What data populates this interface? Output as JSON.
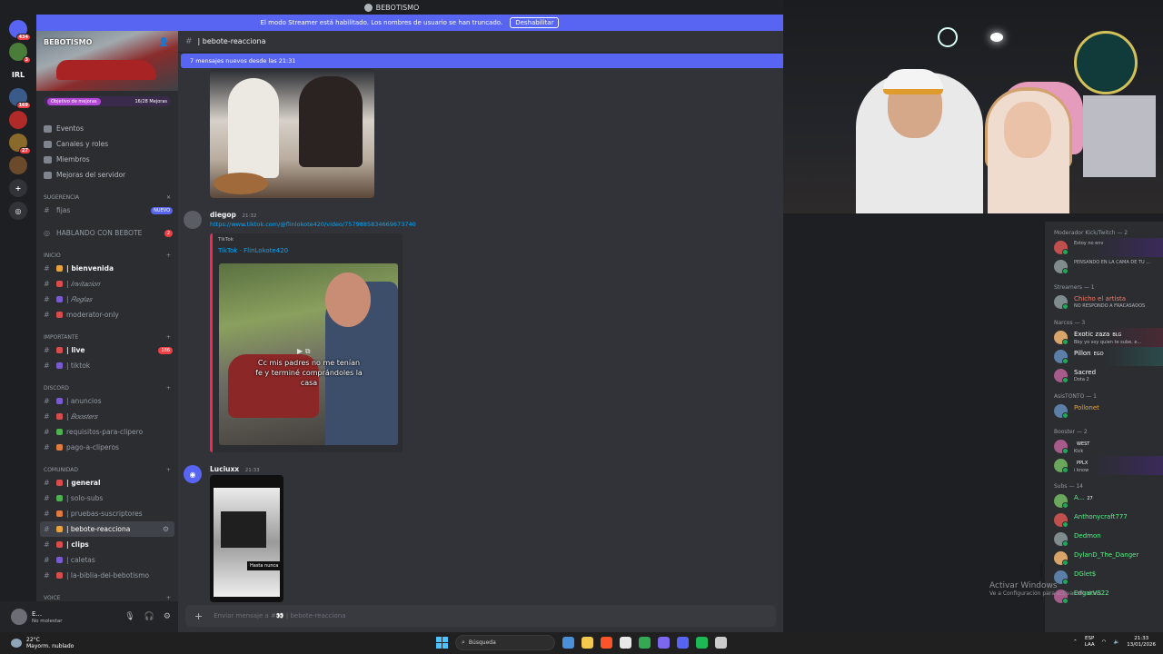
{
  "window": {
    "title": "BEBOTISMO"
  },
  "streamer_banner": {
    "text": "El modo Streamer está habilitado. Los nombres de usuario se han truncado.",
    "button": "Deshabilitar"
  },
  "rail": {
    "servers": [
      {
        "label": "",
        "badge": "434"
      },
      {
        "label": "",
        "badge": "3"
      },
      {
        "label": "IRL",
        "badge": ""
      },
      {
        "label": "",
        "badge": "169"
      },
      {
        "label": "",
        "badge": ""
      },
      {
        "label": "",
        "badge": "27"
      },
      {
        "label": "",
        "badge": ""
      }
    ]
  },
  "server": {
    "name": "BEBOTISMO",
    "boost_label": "Objetivo de mejoras",
    "boost_progress": "16/28 Mejoras",
    "menu": [
      "Eventos",
      "Canales y roles",
      "Miembros",
      "Mejoras del servidor"
    ],
    "sugerencia": {
      "label": "Sugerencia",
      "channel": "fijas",
      "badge": "NUEVO"
    },
    "hablando": {
      "label": "HABLANDO CON BEBOTE",
      "badge": "2"
    },
    "categories": [
      {
        "name": "INICIO",
        "channels": [
          {
            "name": "| bienvenida",
            "state": "unread"
          },
          {
            "name": "| 𝐼𝑛𝑣𝑖𝑡𝑎𝑐𝑖𝑜𝑛",
            "state": "italic"
          },
          {
            "name": "| 𝑅𝑒𝑔𝑙𝑎𝑠",
            "state": "italic"
          },
          {
            "name": "moderator-only",
            "state": "normal"
          }
        ]
      },
      {
        "name": "IMPORTANTE",
        "channels": [
          {
            "name": "| live",
            "state": "unread",
            "badge": "186"
          },
          {
            "name": "| tiktok",
            "state": "normal"
          }
        ]
      },
      {
        "name": "DISCORD",
        "channels": [
          {
            "name": "| anuncios",
            "state": "normal"
          },
          {
            "name": "| 𝐵𝑜𝑜𝑠𝑡𝑒𝑟𝑠",
            "state": "italic"
          },
          {
            "name": "requisitos-para-clipero",
            "state": "normal"
          },
          {
            "name": "pago-a-cliperos",
            "state": "normal"
          }
        ]
      },
      {
        "name": "COMUNIDAD",
        "channels": [
          {
            "name": "| general",
            "state": "unread"
          },
          {
            "name": "| solo-subs",
            "state": "normal"
          },
          {
            "name": "| pruebas-suscriptores",
            "state": "normal"
          },
          {
            "name": "| bebote-reacciona",
            "state": "active"
          },
          {
            "name": "| clips",
            "state": "unread"
          },
          {
            "name": "| caletas",
            "state": "normal"
          },
          {
            "name": "| la-biblia-del-bebotismo",
            "state": "normal"
          }
        ]
      },
      {
        "name": "VOICE",
        "channels": []
      }
    ]
  },
  "user": {
    "name": "E...",
    "status": "No molestar"
  },
  "chat": {
    "channel": "| bebote-reacciona",
    "new_messages": "7 mensajes nuevos desde las 21:31",
    "messages": [
      {
        "author": "diegop",
        "time": "21:32",
        "link": "https://www.tiktok.com/@flinlokote420/video/7579885834669673740",
        "embed": {
          "provider": "TikTok",
          "title": "TikTok · FlinLokote420",
          "caption": "Cc mis padres no me tenían fe y terminé comprándoles la casa"
        }
      },
      {
        "author": "Luciuxx",
        "time": "21:33",
        "image_text": "Hasta nunca"
      }
    ],
    "composer_placeholder": "Enviar mensaje a #👀 | bebote-reacciona"
  },
  "members": {
    "groups": [
      {
        "title": "Moderador Kick/Twitch — 2",
        "members": [
          {
            "name": "",
            "status": "Estoy no env",
            "color": "#5865f2",
            "hl": "hl3"
          },
          {
            "name": "",
            "status": "PENSANDO EN LA CAMA DE TU ...",
            "color": "#5865f2",
            "hl": ""
          }
        ]
      },
      {
        "title": "Streamers — 1",
        "members": [
          {
            "name": "Chicho el artista",
            "status": "NO RESPONDO A FRACASADOS",
            "color": "#f47b67",
            "hl": ""
          }
        ]
      },
      {
        "title": "Narcos — 3",
        "members": [
          {
            "name": "Exotic zaza",
            "status": "Bby yo soy quien te sube, e...",
            "color": "#ffffff",
            "tag": "BLG",
            "hl": "hl"
          },
          {
            "name": "Pillon",
            "status": "",
            "color": "#ffffff",
            "tag": "EGO",
            "hl": "hl2"
          },
          {
            "name": "Sacred",
            "status": "Dota 2",
            "color": "#ffffff",
            "hl": ""
          }
        ]
      },
      {
        "title": "AsisTONTO — 1",
        "members": [
          {
            "name": "Pollonet",
            "status": "",
            "color": "#f0a02a",
            "hl": ""
          }
        ]
      },
      {
        "title": "Booster — 2",
        "members": [
          {
            "name": "",
            "status": "Kick",
            "color": "#ff73fa",
            "tag": "WEST",
            "hl": ""
          },
          {
            "name": "",
            "status": "i know",
            "color": "#ff73fa",
            "tag": "PPLX",
            "hl": "hl3"
          }
        ]
      },
      {
        "title": "Subs — 14",
        "members": [
          {
            "name": "A...",
            "status": "",
            "color": "#57f287",
            "tag": "27",
            "hl": ""
          },
          {
            "name": "Anthonycraft777",
            "status": "",
            "color": "#57f287",
            "hl": ""
          },
          {
            "name": "Dedmon",
            "status": "",
            "color": "#57f287",
            "hl": ""
          },
          {
            "name": "DylanD_The_Danger",
            "status": "",
            "color": "#57f287",
            "hl": ""
          },
          {
            "name": "DGlet$",
            "status": "",
            "color": "#57f287",
            "hl": ""
          },
          {
            "name": "EdgarVS22",
            "status": "",
            "color": "#57f287",
            "hl": ""
          }
        ]
      }
    ]
  },
  "watermark": {
    "line1": "Activar Windows",
    "line2": "Ve a Configuración para activar Windows."
  },
  "taskbar": {
    "weather_temp": "22°C",
    "weather_desc": "Mayorm. nublado",
    "search": "Búsqueda",
    "lang1": "ESP",
    "lang2": "LAA",
    "time": "21:33",
    "date": "13/01/2026",
    "apps": [
      "#4a90d9",
      "#f2c94c",
      "#fb542b",
      "#e8e8e8",
      "#34a853",
      "#7b68ee",
      "#5865f2",
      "#1db954",
      "#cccccc"
    ]
  },
  "colors": {
    "accent": "#5865f2",
    "danger": "#f23f43",
    "link": "#00a8fc",
    "tiktok": "#f02a52"
  }
}
